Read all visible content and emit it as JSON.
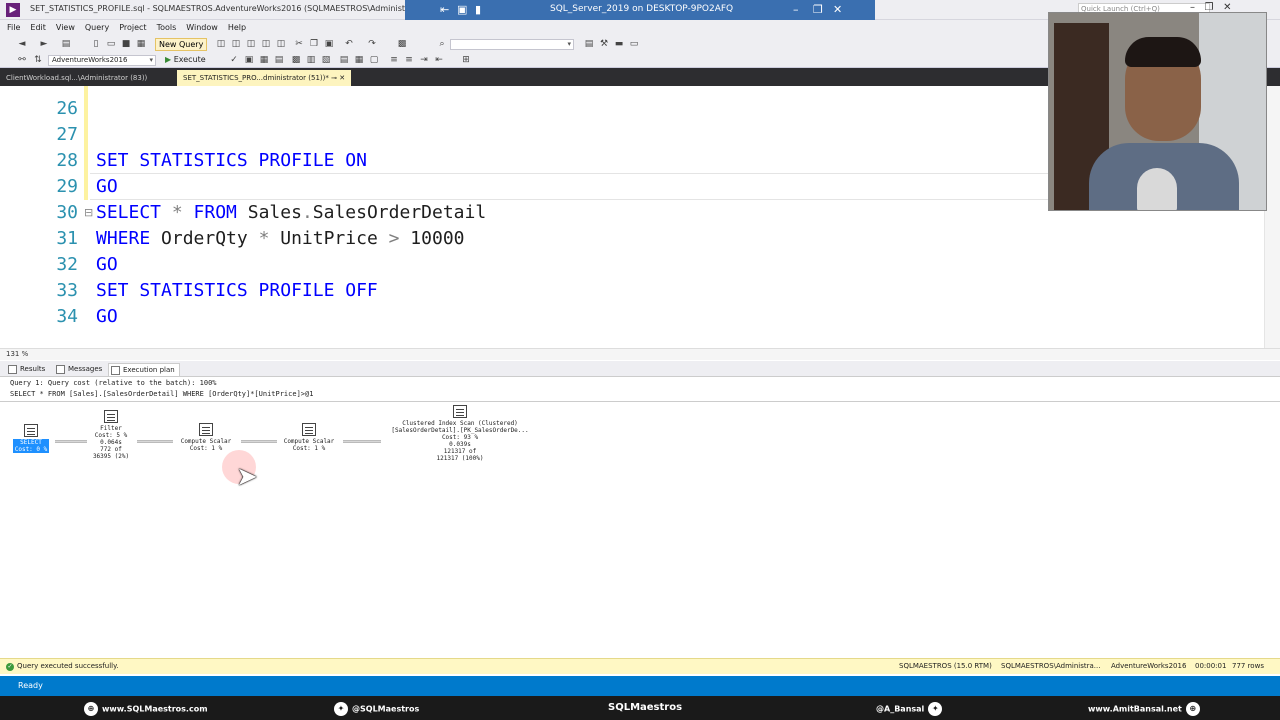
{
  "titlebar": {
    "window_title": "SET_STATISTICS_PROFILE.sql - SQLMAESTROS.AdventureWorks2016 (SQLMAESTROS\\Administrator (51))* -",
    "remote_title": "SQL_Server_2019 on DESKTOP-9PO2AFQ",
    "quick_launch_placeholder": "Quick Launch (Ctrl+Q)"
  },
  "menu": [
    "File",
    "Edit",
    "View",
    "Query",
    "Project",
    "Tools",
    "Window",
    "Help"
  ],
  "toolbar": {
    "new_query_label": "New Query",
    "database": "AdventureWorks2016",
    "execute_label": "Execute"
  },
  "doc_tabs": [
    {
      "label": "ClientWorkload.sql...\\Administrator (83))"
    },
    {
      "label": "SET_STATISTICS_PRO...dministrator (51))*",
      "active": true
    }
  ],
  "editor": {
    "lines": [
      {
        "num": "26"
      },
      {
        "num": "27"
      },
      {
        "num": "28",
        "t1": "SET STATISTICS PROFILE ON"
      },
      {
        "num": "29",
        "t1": "GO"
      },
      {
        "num": "30",
        "t1": "SELECT",
        "t2": " * ",
        "t3": "FROM",
        "t4": " Sales",
        "t5": ".",
        "t6": "SalesOrderDetail"
      },
      {
        "num": "31",
        "t1": "WHERE",
        "t2": " OrderQty ",
        "t3": "*",
        "t4": " UnitPrice ",
        "t5": ">",
        "t6": " 10000"
      },
      {
        "num": "32",
        "t1": "GO"
      },
      {
        "num": "33",
        "t1": "SET STATISTICS PROFILE OFF"
      },
      {
        "num": "34",
        "t1": "GO"
      }
    ],
    "zoom": "131 %"
  },
  "result_tabs": [
    "Results",
    "Messages",
    "Execution plan"
  ],
  "plan": {
    "query_header": "Query 1: Query cost (relative to the batch): 100%",
    "query_text": "SELECT * FROM [Sales].[SalesOrderDetail] WHERE [OrderQty]*[UnitPrice]>@1",
    "operators": [
      {
        "name": "SELECT",
        "cost": "Cost: 0 %"
      },
      {
        "name": "Filter",
        "cost": "Cost: 5 %",
        "time": "0.064s",
        "rows": "772 of",
        "est": "36395 (2%)"
      },
      {
        "name": "Compute Scalar",
        "cost": "Cost: 1 %"
      },
      {
        "name": "Compute Scalar",
        "cost": "Cost: 1 %"
      },
      {
        "name": "Clustered Index Scan (Clustered)",
        "object": "[SalesOrderDetail].[PK_SalesOrderDe...",
        "cost": "Cost: 93 %",
        "time": "0.039s",
        "rows": "121317 of",
        "est": "121317 (100%)"
      }
    ]
  },
  "status": {
    "message": "Query executed successfully.",
    "server": "SQLMAESTROS (15.0 RTM)",
    "user": "SQLMAESTROS\\Administra...",
    "database": "AdventureWorks2016",
    "elapsed": "00:00:01",
    "rows": "777 rows"
  },
  "ready": "Ready",
  "footer": {
    "site": "www.SQLMaestros.com",
    "twitter1": "@SQLMaestros",
    "brand": "SQLMaestros",
    "twitter2": "@A_Bansal",
    "site2": "www.AmitBansal.net"
  }
}
